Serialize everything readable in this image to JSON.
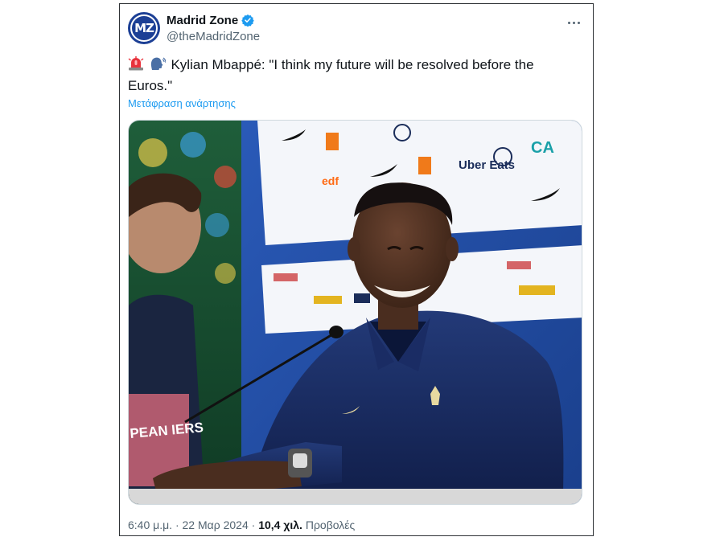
{
  "author": {
    "display_name": "Madrid Zone",
    "handle": "@theMadridZone",
    "avatar_text": "MZ",
    "verified": true
  },
  "tweet": {
    "text": "Kylian Mbappé: \"I think my future will be resolved before the Euros.\"",
    "emojis": [
      "siren-icon",
      "speaking-head-icon"
    ],
    "translate_label": "Μετάφραση ανάρτησης"
  },
  "media": {
    "backdrop_logos": [
      "Uber Eats",
      "edf",
      "CA"
    ],
    "nameplate_text": "PEAN IERS"
  },
  "footer": {
    "time": "6:40 μ.μ.",
    "separator": " · ",
    "date": "22 Μαρ 2024",
    "views_count": "10,4 χιλ.",
    "views_label": "Προβολές"
  },
  "colors": {
    "verified": "#1d9bf0",
    "link": "#1d9bf0",
    "text": "#0f1419",
    "secondary": "#536471",
    "avatar_bg": "#1c3f95"
  }
}
